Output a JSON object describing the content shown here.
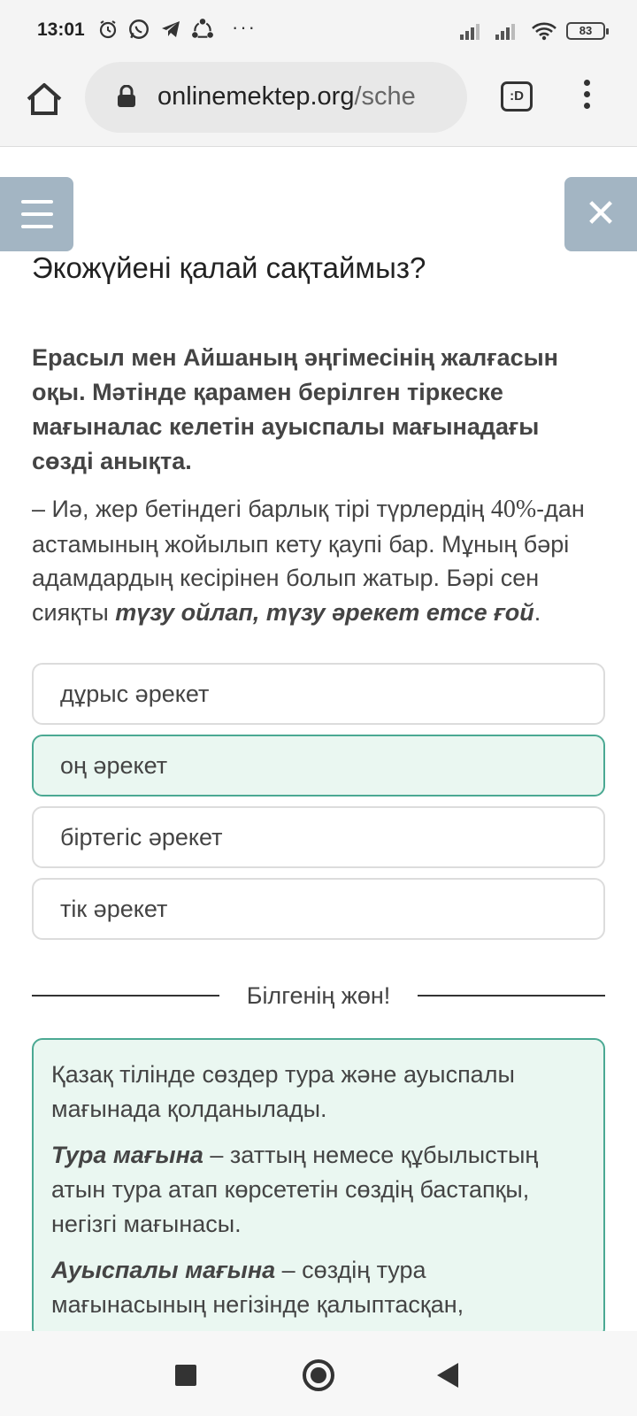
{
  "status_bar": {
    "time": "13:01",
    "more": "···",
    "battery": "83"
  },
  "browser": {
    "url_domain": "onlinemektep.org",
    "url_path": "/sche",
    "tab_switcher": ":D"
  },
  "page": {
    "title": "Экожүйені қалай сақтаймыз?",
    "question": "Ерасыл мен Айшаның әңгімесінің жалғасын оқы. Мәтінде қарамен берілген тіркеске мағыналас келетін ауыспалы мағынадағы сөзді анықта.",
    "passage": {
      "part1": "– Иә, жер бетіндегі барлық тірі түрлердің ",
      "number": "40%",
      "part2": "-дан астамының жойылып кету қаупі бар. Мұның бәрі адамдардың кесірінен болып жатыр. Бәрі сен сияқты ",
      "emphasis": "түзу ойлап, түзу әрекет етсе ғой",
      "end": "."
    },
    "options": [
      {
        "label": "дұрыс әрекет",
        "selected": false
      },
      {
        "label": "оң әрекет",
        "selected": true
      },
      {
        "label": "біртегіс әрекет",
        "selected": false
      },
      {
        "label": "тік әрекет",
        "selected": false
      }
    ],
    "divider_label": "Білгенің жөн!",
    "info": {
      "intro": "Қазақ тілінде сөздер тура және ауыспалы мағынада қолданылады.",
      "term1": "Тура мағына",
      "def1": " – заттың немесе құбылыстың атын тура атап көрсететін сөздің бастапқы, негізгі мағынасы.",
      "term2": "Ауыспалы мағына",
      "def2": " – сөздің тура мағынасының негізінде қалыптасқан,"
    }
  },
  "colors": {
    "accent": "#4ba993",
    "selected_bg": "#eaf7f1",
    "side_button": "#a3b5c3"
  }
}
